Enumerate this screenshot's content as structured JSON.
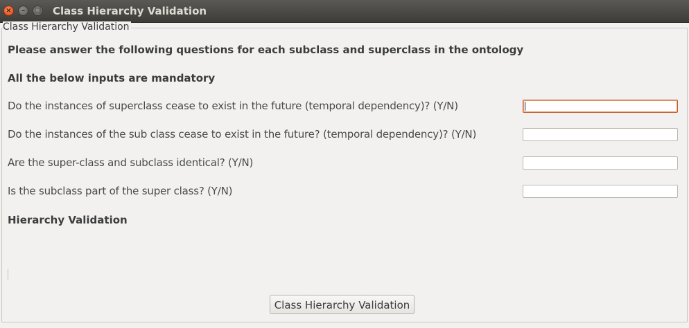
{
  "window": {
    "title": "Class Hierarchy Validation",
    "close_glyph": "×",
    "min_glyph": "–",
    "max_glyph": "□"
  },
  "panel": {
    "legend": "Class Hierarchy Validation",
    "instruction": "Please answer the following questions for each subclass and superclass in the ontology",
    "mandatory_note": "All the below inputs are mandatory",
    "questions": [
      {
        "label": "Do the instances of superclass cease to exist in the future (temporal dependency)? (Y/N)",
        "value": ""
      },
      {
        "label": "Do the instances of the sub class cease to exist in the future? (temporal dependency)? (Y/N)",
        "value": ""
      },
      {
        "label": "Are the super-class and subclass identical? (Y/N)",
        "value": ""
      },
      {
        "label": "Is the subclass part of the super class? (Y/N)",
        "value": ""
      }
    ],
    "result_heading": "Hierarchy Validation",
    "result_text": "",
    "button_label": "Class Hierarchy Validation"
  },
  "colors": {
    "titlebar": "#3d3c38",
    "close_button": "#df4a16",
    "background": "#f2f1f0",
    "focus_border": "#c25a2a"
  },
  "icons": {
    "close": "close-icon",
    "minimize": "minimize-icon",
    "maximize": "maximize-icon"
  }
}
